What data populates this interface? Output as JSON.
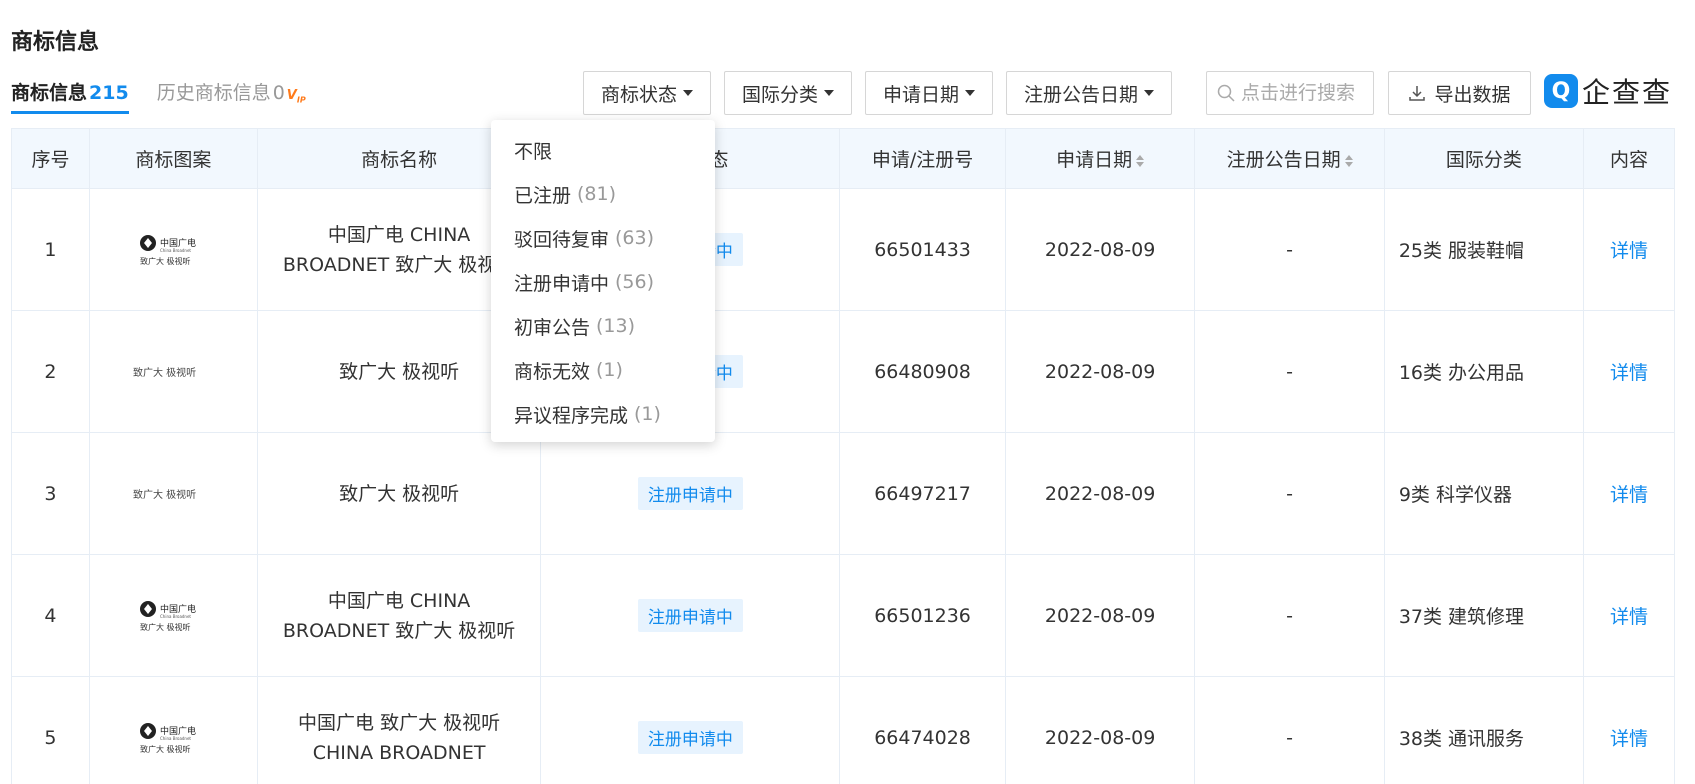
{
  "section_title": "商标信息",
  "tabs": [
    {
      "label": "商标信息",
      "count": "215"
    },
    {
      "label": "历史商标信息",
      "count": "0",
      "badge": "VIP"
    }
  ],
  "filters": [
    {
      "label": "商标状态"
    },
    {
      "label": "国际分类"
    },
    {
      "label": "申请日期"
    },
    {
      "label": "注册公告日期"
    }
  ],
  "search": {
    "placeholder": "点击进行搜索"
  },
  "export_label": "导出数据",
  "brand": {
    "logo_icon": "qcc-logo-icon",
    "text": "企查查",
    "color": "#128bed"
  },
  "table": {
    "headers": [
      "序号",
      "商标图案",
      "商标名称",
      "商标状态",
      "申请/注册号",
      "申请日期",
      "注册公告日期",
      "国际分类",
      "内容"
    ],
    "rows": [
      {
        "index": "1",
        "logo": "中国广电 China Broadnet 致广大 极视听",
        "name": "中国广电 CHINA BROADNET 致广大 极视听",
        "status": "注册申请中",
        "reg_no": "66501433",
        "apply_date": "2022-08-09",
        "notice_date": "-",
        "class": "25类 服装鞋帽",
        "detail": "详情"
      },
      {
        "index": "2",
        "logo": "致广大 极视听",
        "name": "致广大 极视听",
        "status": "注册申请中",
        "reg_no": "66480908",
        "apply_date": "2022-08-09",
        "notice_date": "-",
        "class": "16类 办公用品",
        "detail": "详情"
      },
      {
        "index": "3",
        "logo": "致广大 极视听",
        "name": "致广大 极视听",
        "status": "注册申请中",
        "reg_no": "66497217",
        "apply_date": "2022-08-09",
        "notice_date": "-",
        "class": "9类 科学仪器",
        "detail": "详情"
      },
      {
        "index": "4",
        "logo": "中国广电 China Broadnet 致广大 极视听",
        "name": "中国广电 CHINA BROADNET 致广大 极视听",
        "status": "注册申请中",
        "reg_no": "66501236",
        "apply_date": "2022-08-09",
        "notice_date": "-",
        "class": "37类 建筑修理",
        "detail": "详情"
      },
      {
        "index": "5",
        "logo": "中国广电 China Broadnet 致广大 极视听",
        "name": "中国广电 致广大 极视听 CHINA BROADNET",
        "status": "注册申请中",
        "reg_no": "66474028",
        "apply_date": "2022-08-09",
        "notice_date": "-",
        "class": "38类 通讯服务",
        "detail": "详情"
      }
    ]
  },
  "status_dropdown": {
    "items": [
      {
        "label": "不限",
        "count": ""
      },
      {
        "label": "已注册",
        "count": "(81)"
      },
      {
        "label": "驳回待复审",
        "count": "(63)"
      },
      {
        "label": "注册申请中",
        "count": "(56)"
      },
      {
        "label": "初审公告",
        "count": "(13)"
      },
      {
        "label": "商标无效",
        "count": "(1)"
      },
      {
        "label": "异议程序完成",
        "count": "(1)"
      }
    ]
  }
}
